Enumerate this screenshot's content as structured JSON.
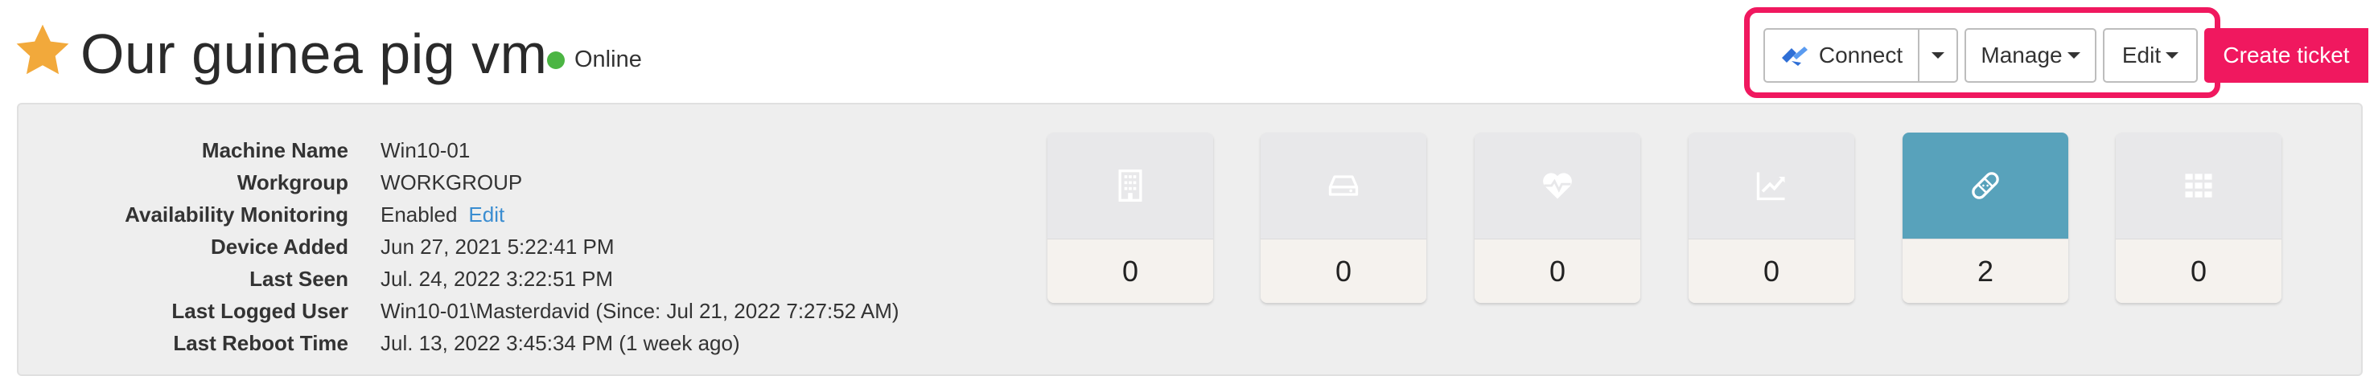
{
  "header": {
    "title": "Our guinea pig vm",
    "status": "Online",
    "favorite_icon": "star-icon",
    "accent": "#f0185f",
    "status_color": "#4bb543",
    "star_color": "#f2a93b"
  },
  "toolbar": {
    "connect_label": "Connect",
    "manage_label": "Manage",
    "edit_label": "Edit",
    "create_ticket_label": "Create ticket"
  },
  "info": {
    "machine_name": {
      "label": "Machine Name",
      "value": "Win10-01"
    },
    "workgroup": {
      "label": "Workgroup",
      "value": "WORKGROUP"
    },
    "availability": {
      "label": "Availability Monitoring",
      "value": "Enabled",
      "link": "Edit"
    },
    "device_added": {
      "label": "Device Added",
      "value": "Jun 27, 2021 5:22:41 PM"
    },
    "last_seen": {
      "label": "Last Seen",
      "value": "Jul. 24, 2022 3:22:51 PM"
    },
    "last_logged_user": {
      "label": "Last Logged User",
      "value": "Win10-01\\Masterdavid (Since: Jul 21, 2022 7:27:52 AM)"
    },
    "last_reboot": {
      "label": "Last Reboot Time",
      "value": "Jul. 13, 2022 3:45:34 PM (1 week ago)"
    }
  },
  "cards": [
    {
      "icon": "building-icon",
      "count": "0"
    },
    {
      "icon": "hard-drive-icon",
      "count": "0"
    },
    {
      "icon": "heartbeat-icon",
      "count": "0"
    },
    {
      "icon": "trend-chart-icon",
      "count": "0"
    },
    {
      "icon": "bandage-icon",
      "count": "2",
      "active": true,
      "active_color": "#58a2bb"
    },
    {
      "icon": "grid-icon",
      "count": "0"
    }
  ]
}
